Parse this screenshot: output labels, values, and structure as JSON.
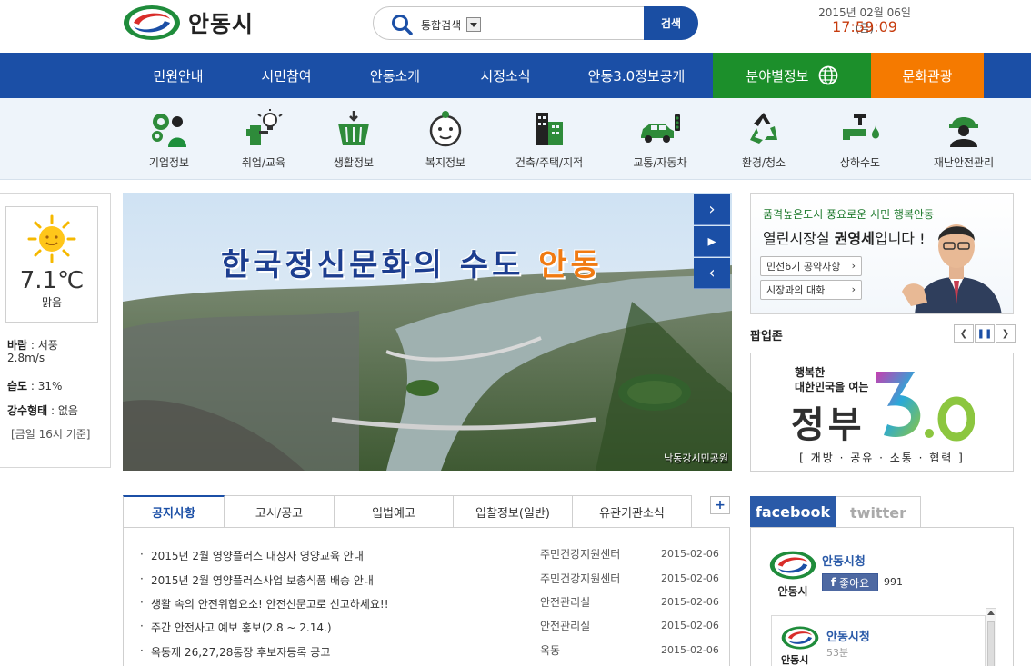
{
  "header": {
    "logo_text": "안동시",
    "search": {
      "scope": "통합검색",
      "button": "검색"
    },
    "date": "2015년 02월 06일(금)",
    "time": "17:59:09"
  },
  "nav": {
    "items": [
      "민원안내",
      "시민참여",
      "안동소개",
      "시정소식",
      "안동3.0정보공개",
      "분야별정보",
      "문화관광"
    ]
  },
  "categories": [
    {
      "label": "기업정보",
      "icon": "business-icon"
    },
    {
      "label": "취업/교육",
      "icon": "education-icon"
    },
    {
      "label": "생활정보",
      "icon": "basket-icon"
    },
    {
      "label": "복지정보",
      "icon": "baby-icon"
    },
    {
      "label": "건축/주택/지적",
      "icon": "building-icon"
    },
    {
      "label": "교통/자동차",
      "icon": "car-icon"
    },
    {
      "label": "환경/청소",
      "icon": "recycle-icon"
    },
    {
      "label": "상하수도",
      "icon": "water-icon"
    },
    {
      "label": "재난안전관리",
      "icon": "helmet-icon"
    }
  ],
  "weather": {
    "temp": "7.1℃",
    "cond": "맑음",
    "wind_label": "바람",
    "wind_value": " : 서풍",
    "wind_speed": "2.8m/s",
    "humidity_label": "습도",
    "humidity_value": " : 31%",
    "rain_label": "강수형태",
    "rain_value": " : 없음",
    "basis": "[금일 16시 기준]"
  },
  "banner": {
    "title_main": "한국정신문화의 수도 ",
    "title_hl": "안동",
    "caption": "낙동강시민공원",
    "ctrls": [
      "›",
      "▸",
      "‹"
    ]
  },
  "mayor": {
    "slogan": "품격높은도시 풍요로운 시민 행복안동",
    "title_pre": "열린시장실 ",
    "title_name": "권영세",
    "title_post": "입니다 !",
    "btn1": "민선6기 공약사항",
    "btn2": "시장과의 대화"
  },
  "popup": {
    "title": "팝업존",
    "line1": "행복한",
    "line2": "대한민국을 여는",
    "word": "정부",
    "num": "3.0",
    "sub": "[ 개방 · 공유 · 소통 · 협력 ]"
  },
  "notices": {
    "tabs": [
      "공지사항",
      "고시/공고",
      "입법예고",
      "입찰정보(일반)",
      "유관기관소식"
    ],
    "rows": [
      {
        "title": "2015년 2월 영양플러스 대상자 영양교육 안내",
        "dept": "주민건강지원센터",
        "date": "2015-02-06"
      },
      {
        "title": "2015년 2월 영양플러스사업 보충식품 배송 안내",
        "dept": "주민건강지원센터",
        "date": "2015-02-06"
      },
      {
        "title": "생활 속의 안전위협요소! 안전신문고로 신고하세요!!",
        "dept": "안전관리실",
        "date": "2015-02-06"
      },
      {
        "title": "주간 안전사고 예보 홍보(2.8 ~ 2.14.)",
        "dept": "안전관리실",
        "date": "2015-02-06"
      },
      {
        "title": "옥동제 26,27,28통장 후보자등록 공고",
        "dept": "옥동",
        "date": "2015-02-06"
      }
    ]
  },
  "sns": {
    "tabs": [
      "facebook",
      "twitter"
    ],
    "page_name": "안동시청",
    "like": "좋아요",
    "like_count": "991",
    "logo_label": "안동시",
    "post_name": "안동시청",
    "post_time": "53분"
  },
  "colors": {
    "brand_blue": "#1b4fa6",
    "green": "#1c8f2b",
    "orange": "#f57a00",
    "time_red": "#c63b0d"
  }
}
